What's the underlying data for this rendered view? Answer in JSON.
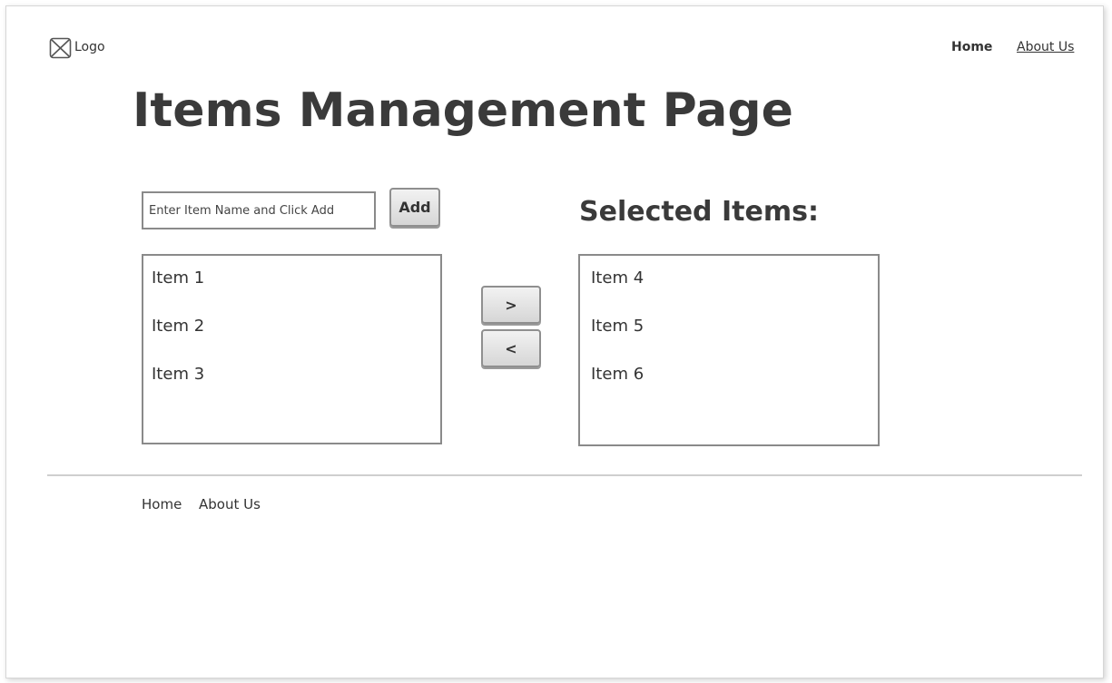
{
  "header": {
    "logo_label": "Logo",
    "nav": {
      "home_label": "Home",
      "about_label": "About Us"
    }
  },
  "main": {
    "title": "Items Management Page",
    "add_form": {
      "input_placeholder": "Enter Item Name and Click Add",
      "input_value": "",
      "add_label": "Add"
    },
    "available_items": [
      "Item 1",
      "Item 2",
      "Item 3"
    ],
    "transfer": {
      "move_right_label": ">",
      "move_left_label": "<"
    },
    "selected": {
      "title": "Selected Items:",
      "items": [
        "Item 4",
        "Item 5",
        "Item 6"
      ]
    }
  },
  "footer": {
    "home_label": "Home",
    "about_label": "About Us"
  },
  "icons": {
    "logo": "image-placeholder-icon"
  }
}
